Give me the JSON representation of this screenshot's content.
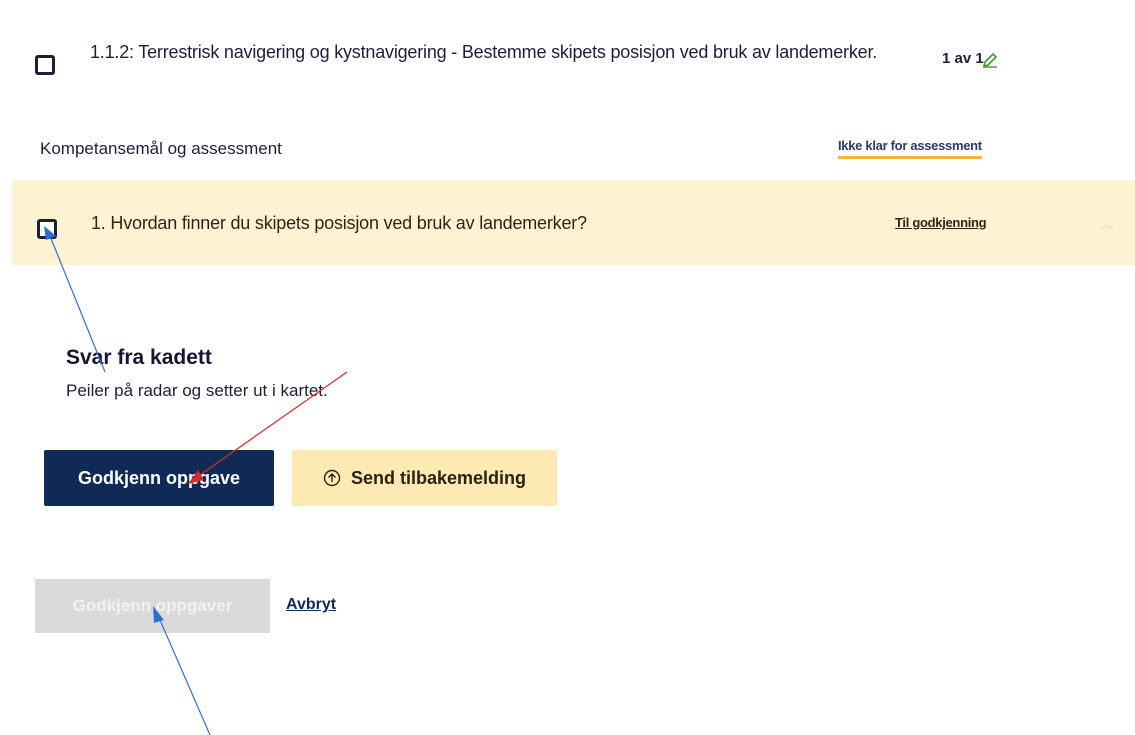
{
  "task": {
    "title": "1.1.2: Terrestrisk navigering og kystnavigering - Bestemme skipets posisjon ved bruk av landemerker.",
    "count": "1 av 1"
  },
  "competence": {
    "label": "Kompetansemål og assessment",
    "status": "Ikke klar for assessment"
  },
  "question": {
    "text": "1. Hvordan finner du skipets posisjon ved bruk av landemerker?",
    "approval_link": "Til godkjenning"
  },
  "answer": {
    "heading": "Svar fra kadett",
    "text": "Peiler på radar og setter ut i kartet."
  },
  "actions": {
    "approve_task": "Godkjenn oppgave",
    "send_feedback": "Send tilbakemelding",
    "approve_tasks_disabled": "Godkjenn oppgaver",
    "cancel": "Avbryt"
  },
  "colors": {
    "primary_button": "#0f2a55",
    "feedback_button": "#fde9b2",
    "question_band": "#fdf3d2",
    "status_underline": "#f3b53d",
    "annotation_blue": "#2f6fd1",
    "annotation_red": "#d42b2b"
  },
  "icons": {
    "task_checkbox": "checkbox-icon",
    "edit": "pencil-icon",
    "question_checkbox": "checkbox-icon",
    "collapse": "chevron-up-icon",
    "feedback": "arrow-up-circle-icon"
  }
}
